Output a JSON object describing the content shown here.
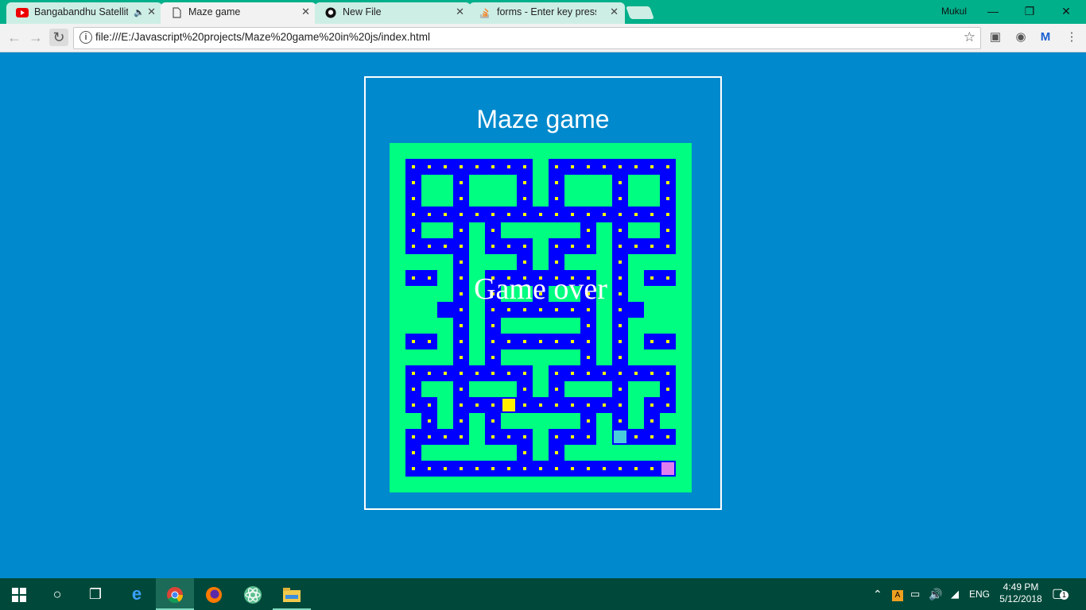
{
  "browser": {
    "tabs": [
      {
        "title": "Bangabandhu Satellite",
        "icon": "youtube-icon",
        "audio": true
      },
      {
        "title": "Maze game",
        "icon": "page-icon",
        "active": true
      },
      {
        "title": "New File",
        "icon": "github-icon"
      },
      {
        "title": "forms - Enter key press e",
        "icon": "stackoverflow-icon"
      }
    ],
    "profile": "Mukul",
    "url": "file:///E:/Javascript%20projects/Maze%20game%20in%20js/index.html",
    "window_buttons": [
      "minimize",
      "restore",
      "close"
    ]
  },
  "game": {
    "title": "Maze game",
    "status": "Game over",
    "colors": {
      "wall": "#00ff80",
      "floor": "#0000ff",
      "pellet": "#ffff00",
      "player": "#ffee00",
      "ghost1": "#48cddc",
      "ghost2": "#e07ef0",
      "background": "#0089cc"
    },
    "grid": [
      "###################",
      "#........#........#",
      "#.##.###.#.###.##.#",
      "#.##.###.#.###.##.#",
      "#.................#",
      "#.##.#.#####.#.##.#",
      "#....#...#...#....#",
      "####.###.#.###.####",
      "   #.#.......#.#   ",
      "####.#.##.##.#.####",
      "#...#..#...#..#...#",
      "####.#.#####.#.####",
      "   #.#.......#.#   ",
      "####.#.#####.#.####",
      "#.......##.......#",
      "#.##.###.#.###.##.#",
      "#..#.....#.......#.#",
      "##.#.#.#####.#.#.##",
      "#....#...#...#....#",
      "#.######.#.#######.#",
      "#.................#",
      "###################"
    ],
    "maze_rows": [
      "###################",
      "#........#........#",
      "#.##.###.#.###.##.#",
      "#.##.###.#.###.##.#",
      "#.................#",
      "#.##.#.#####.#.##.#",
      "#....#...#...#....#",
      "####.###.#.###.####",
      "#..#.#...#...#.#..#",
      "####.#.##.##.#.####",
      "#....#.......#....#",
      "####.#.#####.#.####",
      "#..#.#.......#.#..#",
      "####.#.#####.#.####",
      "#........#........#",
      "#.##.###.#.###.##.#",
      "#..#..........#.#.#",
      "##.#.#.#####.#.#.##",
      "#....#...#...#....#",
      "#.######.#.#######.#",
      "#.................#",
      "###################"
    ]
  },
  "taskbar": {
    "apps": [
      "start-icon",
      "cortana-icon",
      "task-view-icon",
      "edge-icon",
      "chrome-icon",
      "firefox-icon",
      "atom-icon",
      "file-explorer-icon"
    ],
    "language": "ENG",
    "time": "4:49 PM",
    "date": "5/12/2018",
    "notifications": "1"
  }
}
